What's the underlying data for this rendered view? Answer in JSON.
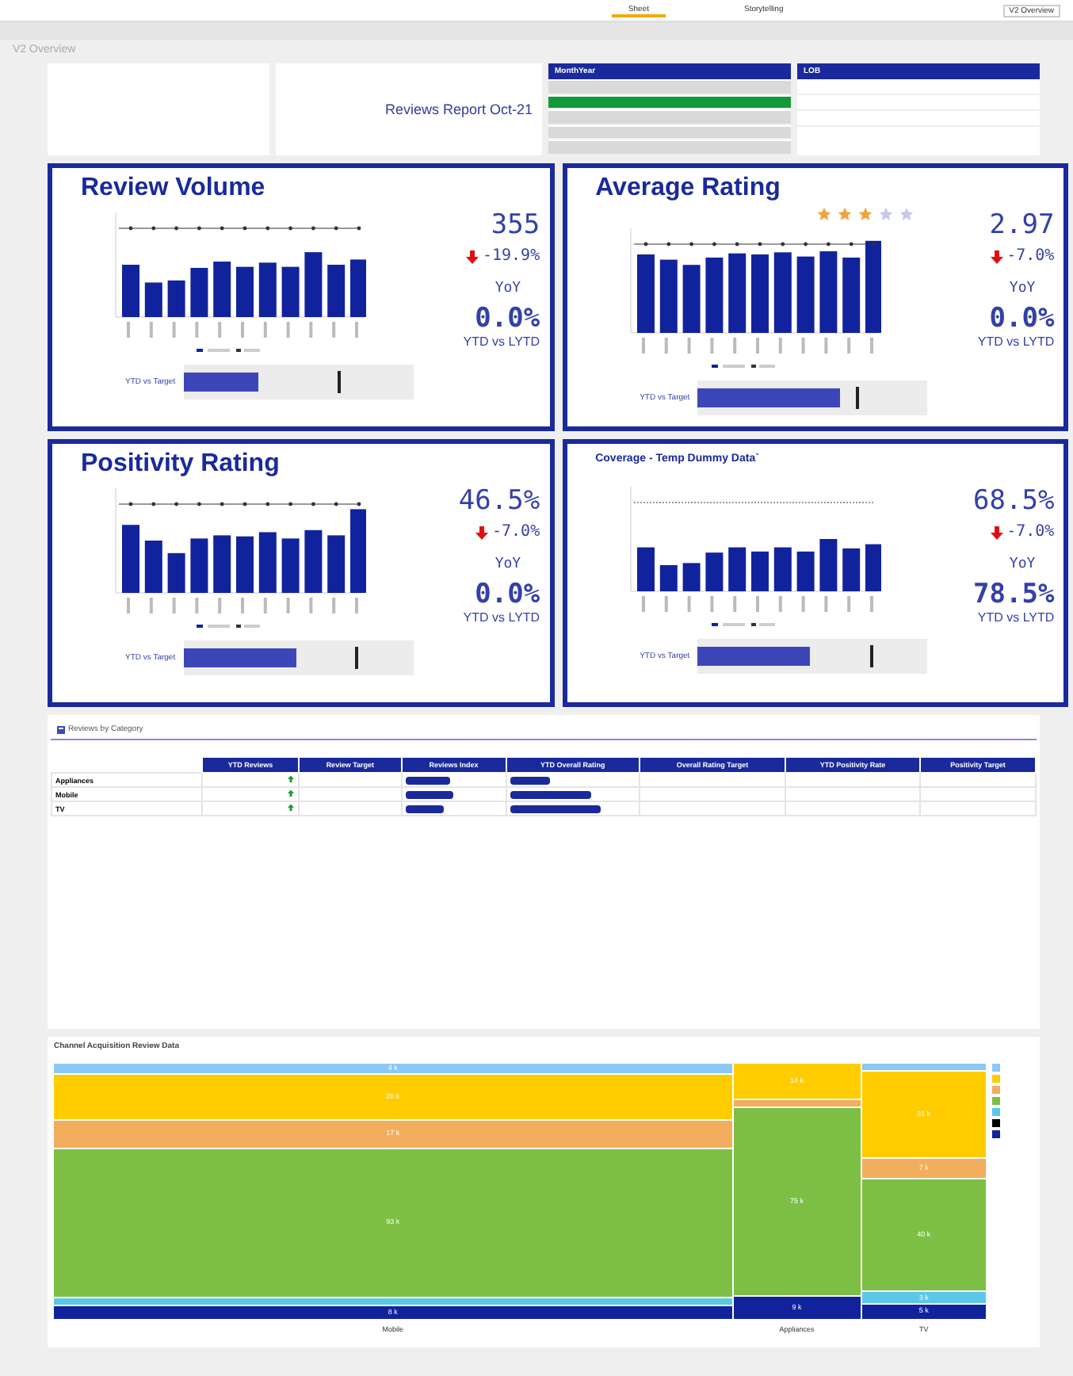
{
  "top_bar": {
    "sheet_tab": "Sheet",
    "story_tab": "Storytelling",
    "sheet_menu": "V2 Overview"
  },
  "breadcrumb": "V2 Overview",
  "header": {
    "report_title": "Reviews Report Oct-21"
  },
  "filters": [
    {
      "title": "MonthYear",
      "items": [
        {
          "selected": false
        },
        {
          "selected": true
        },
        {
          "selected": false
        },
        {
          "selected": false
        },
        {
          "selected": false
        }
      ]
    },
    {
      "title": "LOB",
      "items": [
        {
          "selected": false
        },
        {
          "selected": false
        },
        {
          "selected": false
        }
      ]
    }
  ],
  "cards": [
    {
      "title": "Review Volume",
      "kind": "large",
      "value": "355",
      "change": "-19.9%",
      "change_label": "YoY",
      "ytd_value": "0.0%",
      "ytd_label": "YTD vs LYTD",
      "bullet": {
        "label": "YTD vs Target",
        "level": 0.33,
        "target": {
          "level": 0.67
        }
      }
    },
    {
      "title": "Average Rating",
      "kind": "large",
      "stars": 3,
      "value": "2.97",
      "change": "-7.0%",
      "change_label": "YoY",
      "ytd_value": "0.0%",
      "ytd_label": "YTD vs LYTD",
      "bullet": {
        "label": "YTD vs Target",
        "level": 0.62,
        "target": {
          "level": 0.69
        }
      }
    },
    {
      "title": "Positivity Rating",
      "kind": "large",
      "value": "46.5%",
      "change": "-7.0%",
      "change_label": "YoY",
      "ytd_value": "0.0%",
      "ytd_label": "YTD vs LYTD",
      "bullet": {
        "label": "YTD vs Target",
        "level": 0.49,
        "target": {
          "level": 0.75
        }
      }
    },
    {
      "title": "Coverage - Temp Dummy Data`",
      "kind": "small",
      "value": "68.5%",
      "change": "-7.0%",
      "change_label": "YoY",
      "ytd_value": "78.5%",
      "ytd_label": "YTD vs LYTD",
      "bullet": {
        "label": "YTD vs Target",
        "level": 0.49,
        "target": {
          "level": 0.75
        }
      }
    }
  ],
  "table": {
    "title": "Reviews by Category",
    "columns": [
      "YTD Reviews",
      "Review Target",
      "Reviews Index",
      "YTD Overall Rating",
      "Overall Rating Target",
      "YTD Positivity Rate",
      "Positivity Target"
    ],
    "rows": [
      {
        "name": "Appliances",
        "reviews_index": {
          "level": 0.47
        },
        "overall_rating": {
          "level": 0.32
        }
      },
      {
        "name": "Mobile",
        "reviews_index": {
          "level": 0.5
        },
        "overall_rating": {
          "level": 0.65
        }
      },
      {
        "name": "TV",
        "reviews_index": {
          "level": 0.39
        },
        "overall_rating": {
          "level": 0.72
        }
      }
    ]
  },
  "mosaic": {
    "title": "Channel Acquisition Review Data",
    "columns": [
      {
        "name": "Mobile",
        "segments": [
          {
            "label": "4 k",
            "color": "#8cc8f5"
          },
          {
            "label": "28 k",
            "color": "#ffcc00"
          },
          {
            "label": "17 k",
            "color": "#f2ae5c"
          },
          {
            "label": "93 k",
            "color": "#7cbf44"
          },
          {
            "color": "#5bc8e8"
          },
          {
            "label": "8 k",
            "color": "#11239c"
          }
        ]
      },
      {
        "name": "Appliances",
        "segments": [
          {
            "label": "14 k",
            "color": "#ffcc00"
          },
          {
            "color": "#f2ae5c"
          },
          {
            "label": "75 k",
            "color": "#7cbf44"
          },
          {
            "label": "9 k",
            "color": "#11239c"
          }
        ]
      },
      {
        "name": "TV",
        "segments": [
          {
            "color": "#8cc8f5"
          },
          {
            "label": "31 k",
            "color": "#ffcc00"
          },
          {
            "label": "7 k",
            "color": "#f2ae5c"
          },
          {
            "label": "40 k",
            "color": "#7cbf44"
          },
          {
            "label": "3 k",
            "color": "#5bc8e8"
          },
          {
            "label": "5 k",
            "color": "#11239c"
          }
        ]
      }
    ],
    "legend": [
      {
        "color": "#8cc8f5"
      },
      {
        "color": "#ffcc00"
      },
      {
        "color": "#f2ae5c"
      },
      {
        "color": "#7cbf44"
      },
      {
        "color": "#5bc8e8"
      },
      {
        "color": "#000000"
      },
      {
        "color": "#11239c"
      }
    ]
  }
}
